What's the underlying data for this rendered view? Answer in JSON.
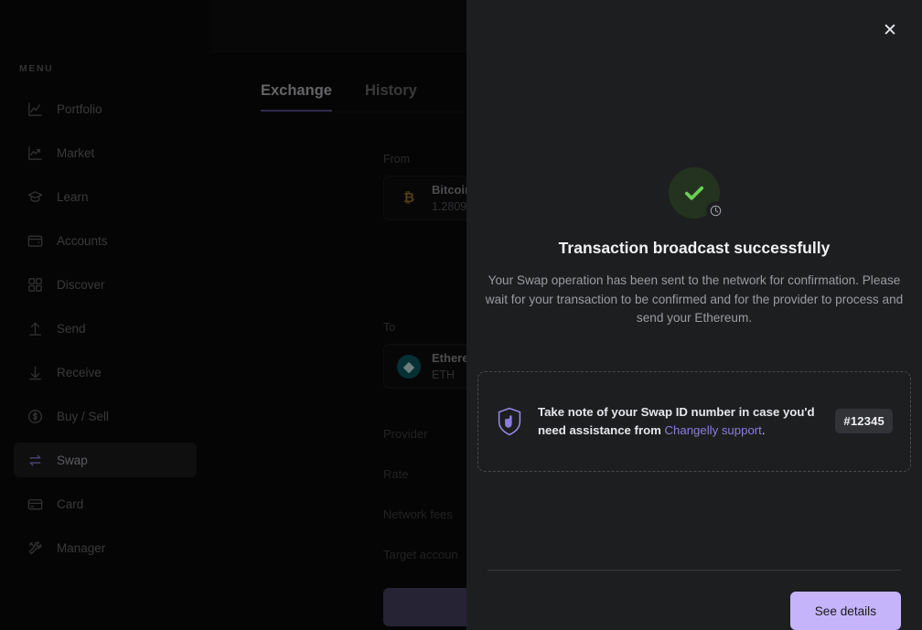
{
  "sidebar": {
    "section_label": "MENU",
    "items": [
      {
        "label": "Portfolio",
        "icon": "chart-line-icon",
        "active": false
      },
      {
        "label": "Market",
        "icon": "market-trend-icon",
        "active": false
      },
      {
        "label": "Learn",
        "icon": "graduation-cap-icon",
        "active": false
      },
      {
        "label": "Accounts",
        "icon": "wallet-icon",
        "active": false
      },
      {
        "label": "Discover",
        "icon": "grid-apps-icon",
        "active": false
      },
      {
        "label": "Send",
        "icon": "arrow-up-send-icon",
        "active": false
      },
      {
        "label": "Receive",
        "icon": "arrow-down-receive-icon",
        "active": false
      },
      {
        "label": "Buy / Sell",
        "icon": "dollar-circle-icon",
        "active": false
      },
      {
        "label": "Swap",
        "icon": "swap-arrows-icon",
        "active": true
      },
      {
        "label": "Card",
        "icon": "credit-card-icon",
        "active": false
      },
      {
        "label": "Manager",
        "icon": "tools-wrench-icon",
        "active": false
      }
    ]
  },
  "main": {
    "tabs": [
      {
        "label": "Exchange",
        "active": true
      },
      {
        "label": "History",
        "active": false
      }
    ],
    "from_label": "From",
    "from_coin": {
      "name": "Bitcoin",
      "amount": "1.2809 ",
      "icon": "bitcoin-icon"
    },
    "to_label": "To",
    "to_coin": {
      "name": "Ethereu",
      "ticker": "ETH",
      "icon": "ethereum-icon"
    },
    "rows": [
      "Provider",
      "Rate",
      "Network fees",
      "Target accoun"
    ]
  },
  "modal": {
    "close_icon": "close-icon",
    "status_icon": "success-check-icon",
    "status_badge_icon": "clock-icon",
    "title": "Transaction broadcast successfully",
    "description": "Your Swap operation has been sent to the network for confirmation. Please wait for your transaction to be confirmed and for the provider to process and send your Ethereum.",
    "notice": {
      "icon": "shield-hand-icon",
      "text_before_link": "Take note of your Swap ID number in case you'd need assistance from ",
      "link_text": "Changelly support",
      "text_after_link": ".",
      "badge": "#12345"
    },
    "primary_button": "See details"
  },
  "colors": {
    "accent": "#c6b4fb",
    "link": "#8b7ee0",
    "success": "#6ad055",
    "drawer_bg": "#1d1e20",
    "app_bg": "#0a0a0b"
  }
}
